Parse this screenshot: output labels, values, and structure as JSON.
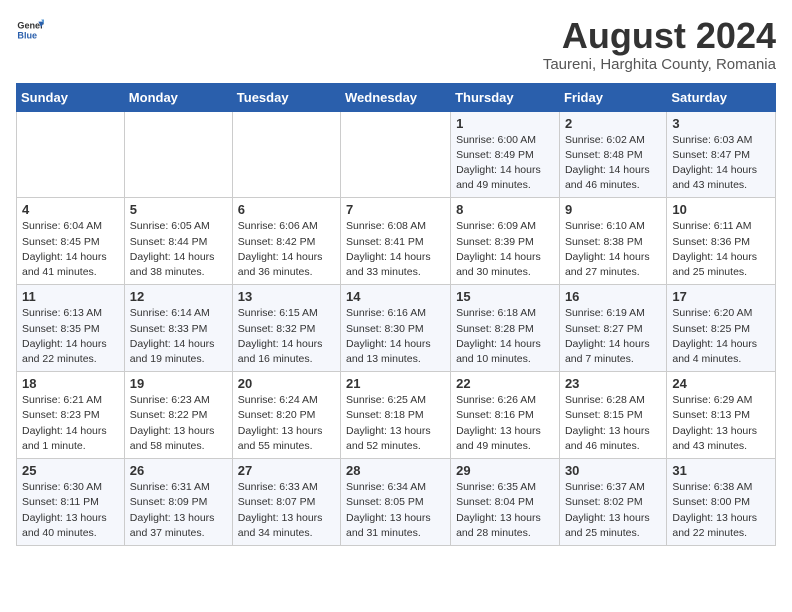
{
  "header": {
    "logo_general": "General",
    "logo_blue": "Blue",
    "month_title": "August 2024",
    "subtitle": "Taureni, Harghita County, Romania"
  },
  "weekdays": [
    "Sunday",
    "Monday",
    "Tuesday",
    "Wednesday",
    "Thursday",
    "Friday",
    "Saturday"
  ],
  "weeks": [
    [
      {
        "day": "",
        "info": ""
      },
      {
        "day": "",
        "info": ""
      },
      {
        "day": "",
        "info": ""
      },
      {
        "day": "",
        "info": ""
      },
      {
        "day": "1",
        "info": "Sunrise: 6:00 AM\nSunset: 8:49 PM\nDaylight: 14 hours and 49 minutes."
      },
      {
        "day": "2",
        "info": "Sunrise: 6:02 AM\nSunset: 8:48 PM\nDaylight: 14 hours and 46 minutes."
      },
      {
        "day": "3",
        "info": "Sunrise: 6:03 AM\nSunset: 8:47 PM\nDaylight: 14 hours and 43 minutes."
      }
    ],
    [
      {
        "day": "4",
        "info": "Sunrise: 6:04 AM\nSunset: 8:45 PM\nDaylight: 14 hours and 41 minutes."
      },
      {
        "day": "5",
        "info": "Sunrise: 6:05 AM\nSunset: 8:44 PM\nDaylight: 14 hours and 38 minutes."
      },
      {
        "day": "6",
        "info": "Sunrise: 6:06 AM\nSunset: 8:42 PM\nDaylight: 14 hours and 36 minutes."
      },
      {
        "day": "7",
        "info": "Sunrise: 6:08 AM\nSunset: 8:41 PM\nDaylight: 14 hours and 33 minutes."
      },
      {
        "day": "8",
        "info": "Sunrise: 6:09 AM\nSunset: 8:39 PM\nDaylight: 14 hours and 30 minutes."
      },
      {
        "day": "9",
        "info": "Sunrise: 6:10 AM\nSunset: 8:38 PM\nDaylight: 14 hours and 27 minutes."
      },
      {
        "day": "10",
        "info": "Sunrise: 6:11 AM\nSunset: 8:36 PM\nDaylight: 14 hours and 25 minutes."
      }
    ],
    [
      {
        "day": "11",
        "info": "Sunrise: 6:13 AM\nSunset: 8:35 PM\nDaylight: 14 hours and 22 minutes."
      },
      {
        "day": "12",
        "info": "Sunrise: 6:14 AM\nSunset: 8:33 PM\nDaylight: 14 hours and 19 minutes."
      },
      {
        "day": "13",
        "info": "Sunrise: 6:15 AM\nSunset: 8:32 PM\nDaylight: 14 hours and 16 minutes."
      },
      {
        "day": "14",
        "info": "Sunrise: 6:16 AM\nSunset: 8:30 PM\nDaylight: 14 hours and 13 minutes."
      },
      {
        "day": "15",
        "info": "Sunrise: 6:18 AM\nSunset: 8:28 PM\nDaylight: 14 hours and 10 minutes."
      },
      {
        "day": "16",
        "info": "Sunrise: 6:19 AM\nSunset: 8:27 PM\nDaylight: 14 hours and 7 minutes."
      },
      {
        "day": "17",
        "info": "Sunrise: 6:20 AM\nSunset: 8:25 PM\nDaylight: 14 hours and 4 minutes."
      }
    ],
    [
      {
        "day": "18",
        "info": "Sunrise: 6:21 AM\nSunset: 8:23 PM\nDaylight: 14 hours and 1 minute."
      },
      {
        "day": "19",
        "info": "Sunrise: 6:23 AM\nSunset: 8:22 PM\nDaylight: 13 hours and 58 minutes."
      },
      {
        "day": "20",
        "info": "Sunrise: 6:24 AM\nSunset: 8:20 PM\nDaylight: 13 hours and 55 minutes."
      },
      {
        "day": "21",
        "info": "Sunrise: 6:25 AM\nSunset: 8:18 PM\nDaylight: 13 hours and 52 minutes."
      },
      {
        "day": "22",
        "info": "Sunrise: 6:26 AM\nSunset: 8:16 PM\nDaylight: 13 hours and 49 minutes."
      },
      {
        "day": "23",
        "info": "Sunrise: 6:28 AM\nSunset: 8:15 PM\nDaylight: 13 hours and 46 minutes."
      },
      {
        "day": "24",
        "info": "Sunrise: 6:29 AM\nSunset: 8:13 PM\nDaylight: 13 hours and 43 minutes."
      }
    ],
    [
      {
        "day": "25",
        "info": "Sunrise: 6:30 AM\nSunset: 8:11 PM\nDaylight: 13 hours and 40 minutes."
      },
      {
        "day": "26",
        "info": "Sunrise: 6:31 AM\nSunset: 8:09 PM\nDaylight: 13 hours and 37 minutes."
      },
      {
        "day": "27",
        "info": "Sunrise: 6:33 AM\nSunset: 8:07 PM\nDaylight: 13 hours and 34 minutes."
      },
      {
        "day": "28",
        "info": "Sunrise: 6:34 AM\nSunset: 8:05 PM\nDaylight: 13 hours and 31 minutes."
      },
      {
        "day": "29",
        "info": "Sunrise: 6:35 AM\nSunset: 8:04 PM\nDaylight: 13 hours and 28 minutes."
      },
      {
        "day": "30",
        "info": "Sunrise: 6:37 AM\nSunset: 8:02 PM\nDaylight: 13 hours and 25 minutes."
      },
      {
        "day": "31",
        "info": "Sunrise: 6:38 AM\nSunset: 8:00 PM\nDaylight: 13 hours and 22 minutes."
      }
    ]
  ]
}
